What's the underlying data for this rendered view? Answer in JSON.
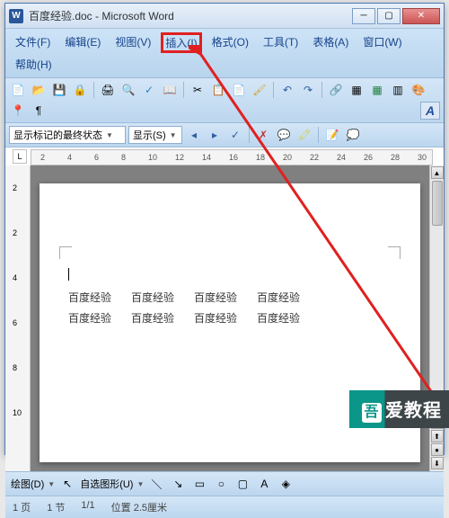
{
  "title": "百度经验.doc - Microsoft Word",
  "title_icon": "W",
  "menus": {
    "file": "文件(F)",
    "edit": "编辑(E)",
    "view": "视图(V)",
    "insert": "插入(I)",
    "format": "格式(O)",
    "tools": "工具(T)",
    "table": "表格(A)",
    "window": "窗口(W)",
    "help": "帮助(H)"
  },
  "toolbar1": {
    "new": "📄",
    "open": "📂",
    "save": "💾",
    "print": "🖨",
    "preview": "🔍",
    "spell": "✓",
    "cut": "✂",
    "copy": "📋",
    "paste": "📄",
    "undo": "↶",
    "redo": "↷",
    "link": "🔗",
    "table": "▦",
    "chart": "📊",
    "zoom": "🔍"
  },
  "format_row": {
    "style_label": "显示标记的最终状态",
    "show_label": "显示(S)",
    "font_a": "A"
  },
  "ruler": {
    "corner": "L",
    "marks": [
      "2",
      "4",
      "6",
      "8",
      "10",
      "12",
      "14",
      "16",
      "18",
      "20",
      "22",
      "24",
      "26",
      "28",
      "30"
    ]
  },
  "vruler": {
    "marks": [
      "2",
      "2",
      "4",
      "6",
      "8",
      "10"
    ]
  },
  "document": {
    "cell": "百度经验"
  },
  "bottom_toolbar": {
    "draw": "绘图(D)",
    "autoshape": "自选图形(U)"
  },
  "statusbar": {
    "page": "1 页",
    "section": "1 节",
    "pageof": "1/1",
    "position": "位置 2.5厘米"
  },
  "watermark": "爱教程"
}
